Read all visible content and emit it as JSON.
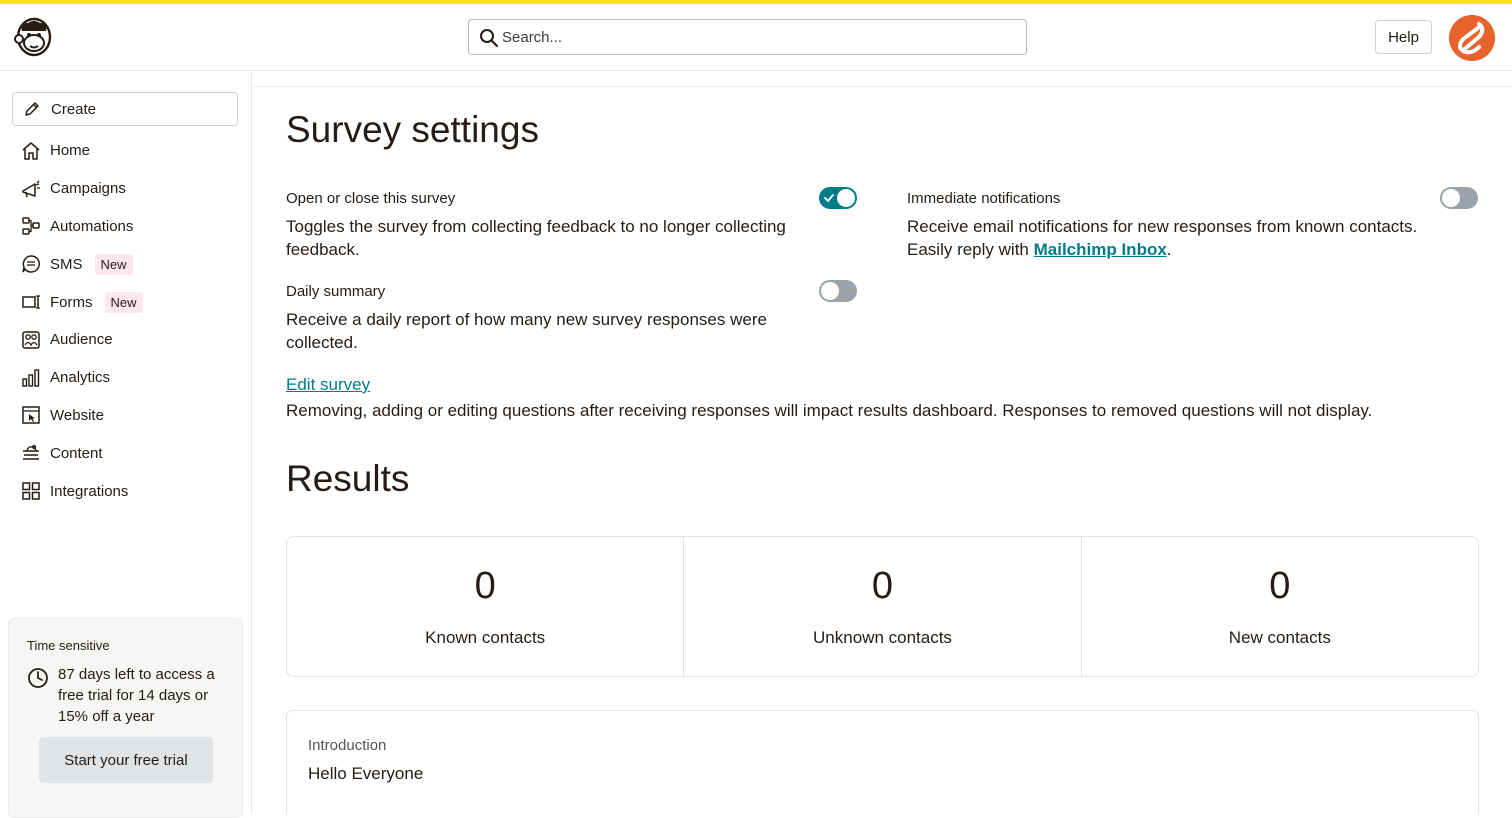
{
  "header": {
    "search_placeholder": "Search...",
    "help_label": "Help"
  },
  "sidebar": {
    "create_label": "Create",
    "items": [
      {
        "label": "Home",
        "icon": "home-icon"
      },
      {
        "label": "Campaigns",
        "icon": "megaphone-icon"
      },
      {
        "label": "Automations",
        "icon": "automations-icon"
      },
      {
        "label": "SMS",
        "icon": "sms-icon",
        "badge": "New"
      },
      {
        "label": "Forms",
        "icon": "forms-icon",
        "badge": "New"
      },
      {
        "label": "Audience",
        "icon": "audience-icon"
      },
      {
        "label": "Analytics",
        "icon": "analytics-icon"
      },
      {
        "label": "Website",
        "icon": "website-icon"
      },
      {
        "label": "Content",
        "icon": "content-icon"
      },
      {
        "label": "Integrations",
        "icon": "integrations-icon"
      }
    ],
    "promo": {
      "label": "Time sensitive",
      "message": "87 days left to access a free trial for 14 days or 15% off a year",
      "button_label": "Start your free trial"
    }
  },
  "main": {
    "title": "Survey settings",
    "settings": {
      "open_close": {
        "title": "Open or close this survey",
        "description": "Toggles the survey from collecting feedback to no longer collecting feedback.",
        "enabled": true
      },
      "daily_summary": {
        "title": "Daily summary",
        "description": "Receive a daily report of how many new survey responses were collected.",
        "enabled": false
      },
      "immediate_notifications": {
        "title": "Immediate notifications",
        "description_prefix": "Receive email notifications for new responses from known contacts. Easily reply with ",
        "link_label": "Mailchimp Inbox",
        "description_suffix": ".",
        "enabled": false
      }
    },
    "edit_survey": {
      "link_label": "Edit survey",
      "description": "Removing, adding or editing questions after receiving responses will impact results dashboard. Responses to removed questions will not display."
    },
    "results": {
      "title": "Results",
      "stats": [
        {
          "value": "0",
          "label": "Known contacts"
        },
        {
          "value": "0",
          "label": "Unknown contacts"
        },
        {
          "value": "0",
          "label": "New contacts"
        }
      ],
      "intro": {
        "label": "Introduction",
        "value": "Hello Everyone"
      }
    }
  },
  "colors": {
    "brand_yellow": "#ffe01b",
    "accent_teal": "#007c89",
    "avatar_orange": "#e8632b",
    "badge_pink": "#fde6ee"
  }
}
